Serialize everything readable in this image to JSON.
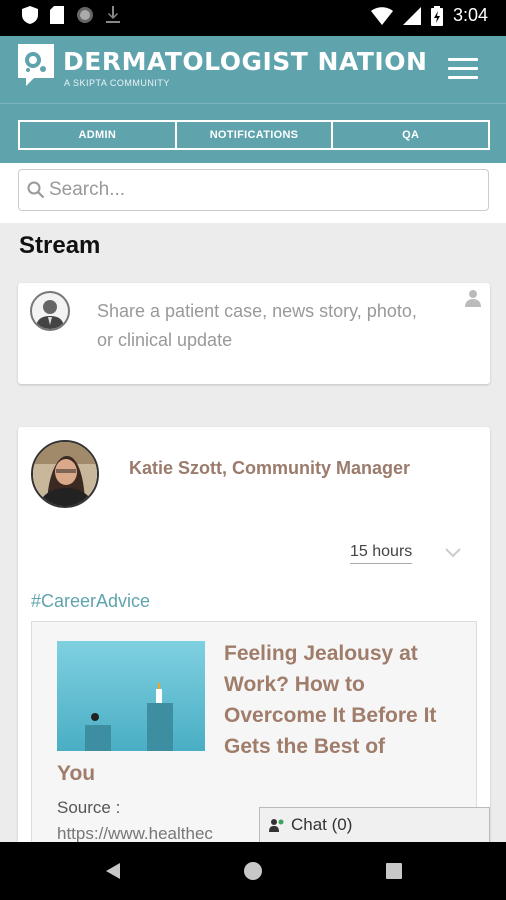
{
  "status_bar": {
    "time": "3:04"
  },
  "header": {
    "brand_title": "DERMATOLOGIST NATION",
    "brand_subtitle": "A SKIPTA COMMUNITY"
  },
  "tabs": [
    {
      "label": "ADMIN"
    },
    {
      "label": "NOTIFICATIONS"
    },
    {
      "label": "QA"
    }
  ],
  "search": {
    "placeholder": "Search..."
  },
  "page": {
    "title": "Stream"
  },
  "share": {
    "prompt": "Share a patient case, news story, photo, or clinical update"
  },
  "post": {
    "author": "Katie Szott, Community Manager",
    "time": "15 hours",
    "hashtag": "#CareerAdvice",
    "article_title": "Feeling Jealousy at Work? How to Overcome It Before It Gets the Best of",
    "article_title_tail": "You",
    "source_label": "Source :",
    "source_url": "https://www.healthec"
  },
  "chat": {
    "label": "Chat (0)"
  },
  "colors": {
    "brand": "#5fa3ad",
    "author": "#9a7b6c",
    "article_title": "#a07d6b"
  }
}
